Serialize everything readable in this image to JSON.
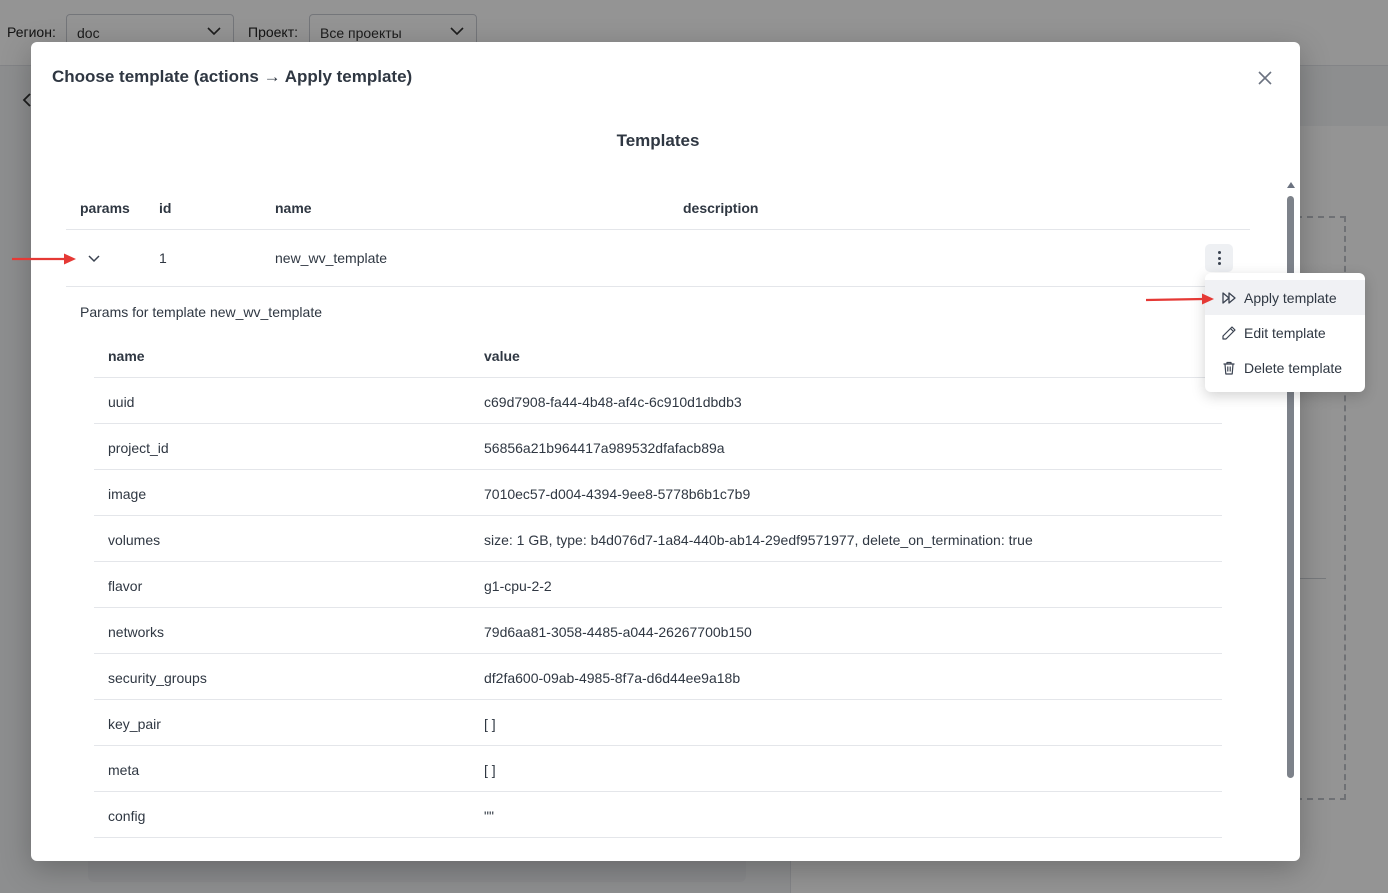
{
  "background": {
    "region_label": "Регион:",
    "region_value": "doc",
    "project_label": "Проект:",
    "project_value": "Все проекты"
  },
  "modal": {
    "title": "Choose template (actions → Apply template)",
    "section_title": "Templates",
    "columns": [
      "params",
      "id",
      "name",
      "description"
    ],
    "row": {
      "id": "1",
      "name": "new_wv_template",
      "description": ""
    },
    "params_caption": "Params for template new_wv_template",
    "params_columns": [
      "name",
      "value"
    ],
    "params": [
      {
        "name": "uuid",
        "value": "c69d7908-fa44-4b48-af4c-6c910d1dbdb3"
      },
      {
        "name": "project_id",
        "value": "56856a21b964417a989532dfafacb89a"
      },
      {
        "name": "image",
        "value": "7010ec57-d004-4394-9ee8-5778b6b1c7b9"
      },
      {
        "name": "volumes",
        "value": "size: 1 GB, type: b4d076d7-1a84-440b-ab14-29edf9571977, delete_on_termination: true"
      },
      {
        "name": "flavor",
        "value": "g1-cpu-2-2"
      },
      {
        "name": "networks",
        "value": "79d6aa81-3058-4485-a044-26267700b150"
      },
      {
        "name": "security_groups",
        "value": "df2fa600-09ab-4985-8f7a-d6d44ee9a18b"
      },
      {
        "name": "key_pair",
        "value": "[ ]"
      },
      {
        "name": "meta",
        "value": "[ ]"
      },
      {
        "name": "config",
        "value": "\"\""
      }
    ]
  },
  "menu": {
    "items": [
      {
        "label": "Apply template",
        "icon": "fast-forward-icon"
      },
      {
        "label": "Edit template",
        "icon": "pencil-icon"
      },
      {
        "label": "Delete template",
        "icon": "trash-icon"
      }
    ]
  },
  "colors": {
    "overlay": "#000000",
    "annotation_arrow": "#e53935",
    "text": "#2f3742"
  }
}
